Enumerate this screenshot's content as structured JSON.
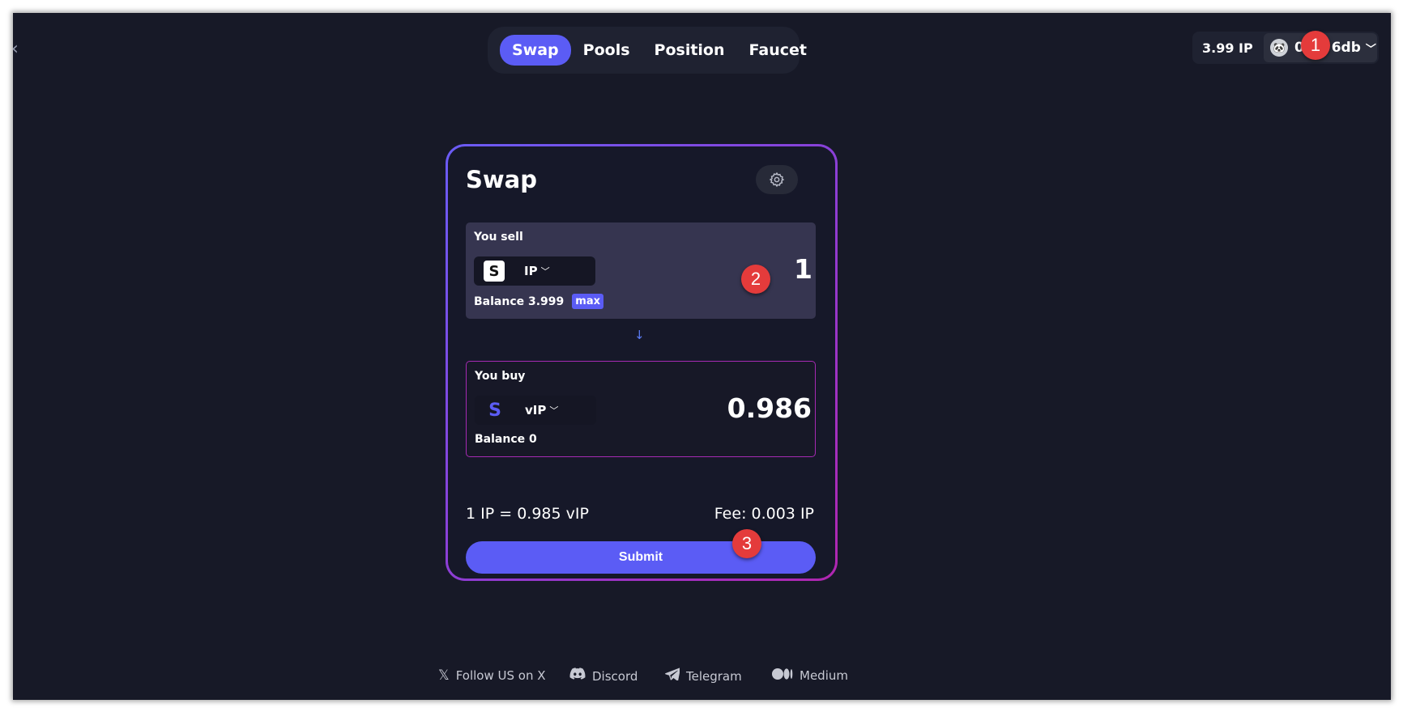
{
  "nav": {
    "tabs": [
      {
        "label": "Swap"
      },
      {
        "label": "Pools"
      },
      {
        "label": "Position"
      },
      {
        "label": "Faucet"
      }
    ]
  },
  "wallet": {
    "balance": "3.99 IP",
    "address": "0x… 6db"
  },
  "markers": [
    "1",
    "2",
    "3"
  ],
  "swap": {
    "title": "Swap",
    "sell": {
      "label": "You sell",
      "token": "IP",
      "amount": "1",
      "balance": "Balance 3.999",
      "max_label": "max"
    },
    "buy": {
      "label": "You buy",
      "token": "vIP",
      "amount": "0.986",
      "balance": "Balance 0"
    },
    "rate": "1 IP = 0.985 vIP",
    "fee": "Fee: 0.003 IP",
    "submit_label": "Submit"
  },
  "footer": {
    "links": [
      {
        "label": "Follow US on X",
        "icon": "x-icon"
      },
      {
        "label": "Discord",
        "icon": "discord-icon"
      },
      {
        "label": "Telegram",
        "icon": "telegram-icon"
      },
      {
        "label": "Medium",
        "icon": "medium-icon"
      }
    ]
  },
  "colors": {
    "background": "#171927",
    "accent": "#5b5cf5",
    "buy_border": "#a62ab3",
    "marker": "#e43b3b"
  }
}
